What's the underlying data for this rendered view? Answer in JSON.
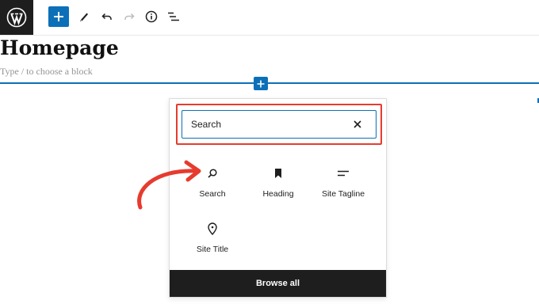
{
  "toolbar": {
    "logo_icon": "wordpress-logo",
    "buttons": [
      "add-block-icon",
      "edit-pencil-icon",
      "undo-icon",
      "redo-icon",
      "info-icon",
      "list-view-icon"
    ]
  },
  "editor": {
    "title": "Homepage",
    "placeholder": "Type / to choose a block"
  },
  "inserter": {
    "search_value": "Search",
    "blocks": [
      {
        "label": "Search",
        "icon": "search-icon"
      },
      {
        "label": "Heading",
        "icon": "bookmark-icon"
      },
      {
        "label": "Site Tagline",
        "icon": "tagline-icon"
      },
      {
        "label": "Site Title",
        "icon": "map-pin-icon"
      }
    ],
    "browse_all": "Browse all"
  },
  "colors": {
    "accent": "#0b70b8",
    "annotation": "#e63b2e",
    "dark": "#1e1e1e"
  }
}
